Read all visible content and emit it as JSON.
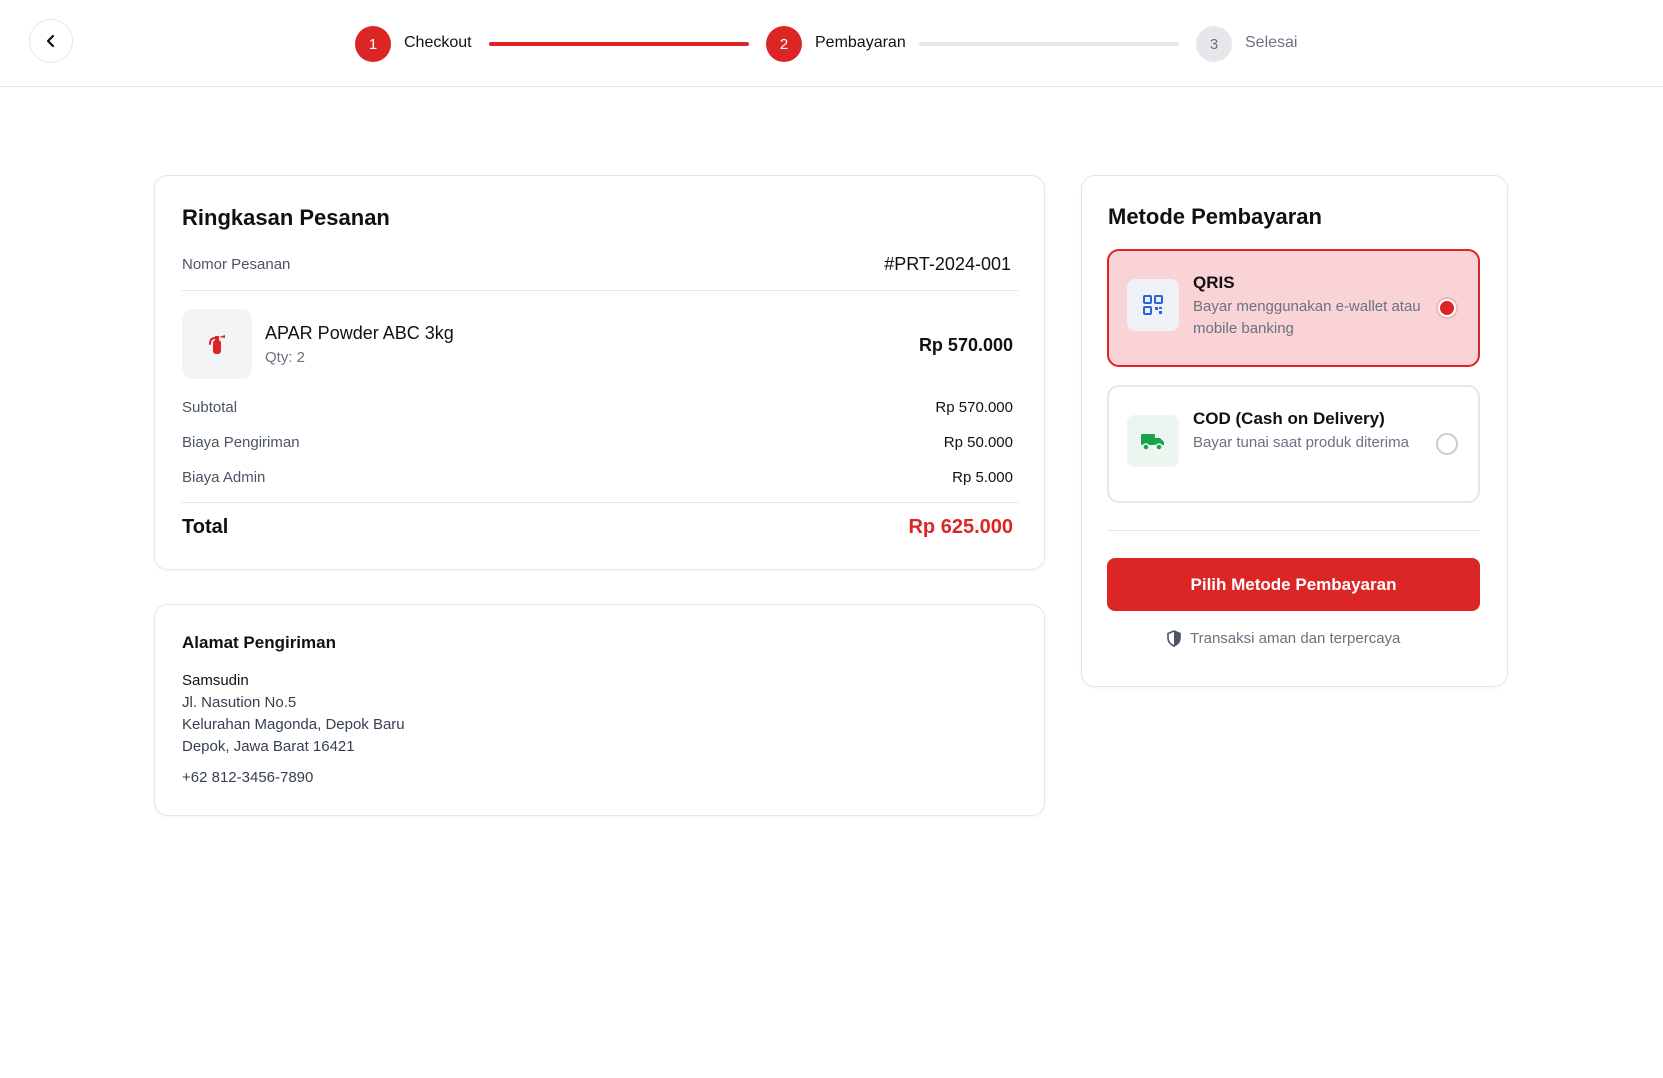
{
  "stepper": {
    "steps": [
      {
        "number": "1",
        "label": "Checkout"
      },
      {
        "number": "2",
        "label": "Pembayaran"
      },
      {
        "number": "3",
        "label": "Selesai"
      }
    ]
  },
  "order_summary": {
    "title": "Ringkasan Pesanan",
    "order_number_label": "Nomor Pesanan",
    "order_number": "#PRT-2024-001",
    "product": {
      "name": "APAR Powder ABC 3kg",
      "qty": "Qty: 2",
      "price": "Rp 570.000",
      "icon": "fire-extinguisher-icon"
    },
    "rows": [
      {
        "label": "Subtotal",
        "value": "Rp 570.000"
      },
      {
        "label": "Biaya Pengiriman",
        "value": "Rp 50.000"
      },
      {
        "label": "Biaya Admin",
        "value": "Rp 5.000"
      }
    ],
    "total_label": "Total",
    "total_value": "Rp 625.000"
  },
  "shipping": {
    "title": "Alamat Pengiriman",
    "name": "Samsudin",
    "address_lines": [
      "Jl. Nasution No.5",
      "Kelurahan Magonda, Depok Baru",
      "Depok, Jawa Barat 16421"
    ],
    "phone": "+62 812-3456-7890"
  },
  "payment": {
    "title": "Metode Pembayaran",
    "options": [
      {
        "title": "QRIS",
        "desc": "Bayar menggunakan e-wallet atau mobile banking",
        "icon": "qr-code-icon",
        "selected": true
      },
      {
        "title": "COD (Cash on Delivery)",
        "desc": "Bayar tunai saat produk diterima",
        "icon": "truck-icon",
        "selected": false
      }
    ],
    "cta_label": "Pilih Metode Pembayaran",
    "secure_note": "Transaksi aman dan terpercaya"
  },
  "colors": {
    "accent": "#dc2626",
    "selected_bg": "#f9d3d5",
    "qris_icon": "#2563eb",
    "cod_icon": "#16a34a"
  }
}
